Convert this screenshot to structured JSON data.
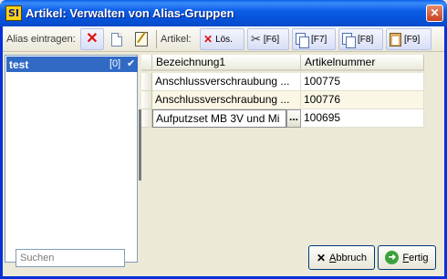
{
  "window": {
    "logo": "SI",
    "title": "Artikel: Verwalten von Alias-Gruppen",
    "close_glyph": "✕"
  },
  "toolbar": {
    "alias_label": "Alias eintragen:",
    "artikel_label": "Artikel:",
    "loes_label": "Lös.",
    "f6_label": "[F6]",
    "f7_label": "[F7]",
    "f8_label": "[F8]",
    "f9_label": "[F9]"
  },
  "alias_list": {
    "items": [
      {
        "name": "test",
        "count": "[0]",
        "check": "✔"
      }
    ]
  },
  "grid": {
    "columns": [
      "Bezeichnung1",
      "Artikelnummer"
    ],
    "rows": [
      {
        "bezeichnung": "Anschlussverschraubung ...",
        "nummer": "100775"
      },
      {
        "bezeichnung": "Anschlussverschraubung ...",
        "nummer": "100776"
      },
      {
        "bezeichnung": "Aufputzset MB 3V und Mi",
        "nummer": "100695"
      }
    ],
    "ellipsis": "..."
  },
  "search": {
    "placeholder": "Suchen"
  },
  "buttons": {
    "abbruch_access": "A",
    "abbruch_rest": "bbruch",
    "fertig_access": "F",
    "fertig_rest": "ertig"
  },
  "colors": {
    "selection": "#316ac5",
    "title_bar": "#0553db"
  }
}
